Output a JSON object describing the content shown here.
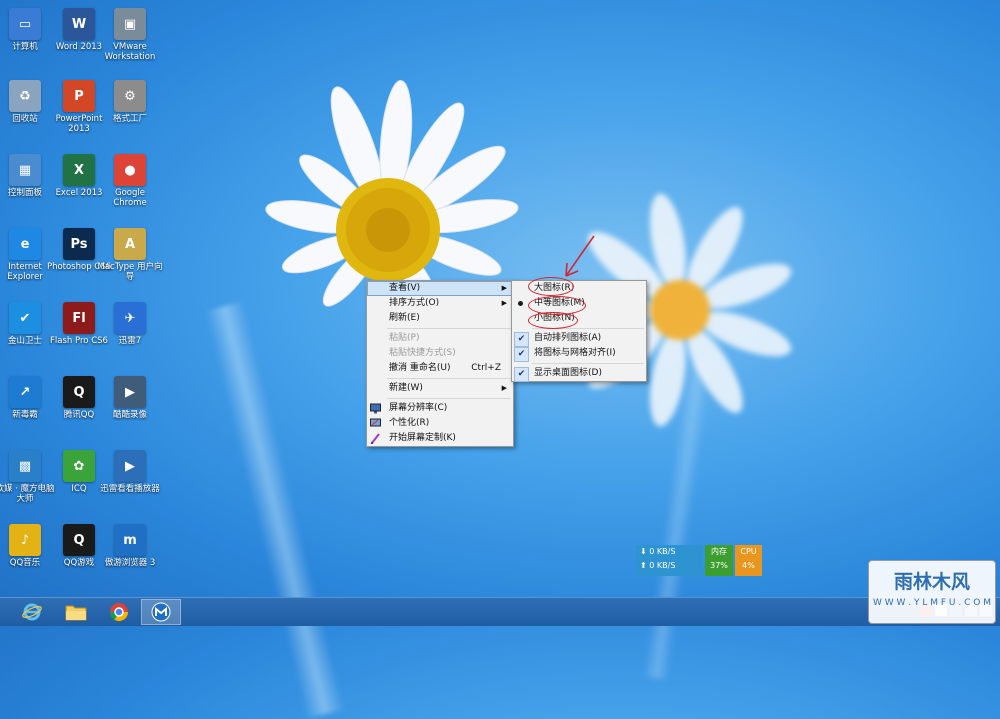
{
  "desktop_icons": [
    {
      "name": "desktop-icon-computer",
      "label": "计算机",
      "glyph": "▭",
      "color": "#3a7bd5",
      "col": 0,
      "row": 0
    },
    {
      "name": "desktop-icon-word",
      "label": "Word 2013",
      "glyph": "W",
      "color": "#2b579a",
      "col": 1,
      "row": 0
    },
    {
      "name": "desktop-icon-vmware",
      "label": "VMware Workstation",
      "glyph": "▣",
      "color": "#7a8b9a",
      "col": 2,
      "row": 0
    },
    {
      "name": "desktop-icon-recycle-bin",
      "label": "回收站",
      "glyph": "♻",
      "color": "#8aa4bf",
      "col": 0,
      "row": 1
    },
    {
      "name": "desktop-icon-powerpoint",
      "label": "PowerPoint 2013",
      "glyph": "P",
      "color": "#d24726",
      "col": 1,
      "row": 1
    },
    {
      "name": "desktop-icon-format-factory",
      "label": "格式工厂",
      "glyph": "⚙",
      "color": "#8c8c8c",
      "col": 2,
      "row": 1
    },
    {
      "name": "desktop-icon-control-panel",
      "label": "控制面板",
      "glyph": "▦",
      "color": "#4b8bd0",
      "col": 0,
      "row": 2
    },
    {
      "name": "desktop-icon-excel",
      "label": "Excel 2013",
      "glyph": "X",
      "color": "#217346",
      "col": 1,
      "row": 2
    },
    {
      "name": "desktop-icon-chrome",
      "label": "Google Chrome",
      "glyph": "●",
      "color": "#db4437",
      "col": 2,
      "row": 2
    },
    {
      "name": "desktop-icon-ie",
      "label": "Internet Explorer",
      "glyph": "e",
      "color": "#1e88e5",
      "col": 0,
      "row": 3
    },
    {
      "name": "desktop-icon-photoshop",
      "label": "Photoshop CS6",
      "glyph": "Ps",
      "color": "#0c2a4d",
      "col": 1,
      "row": 3
    },
    {
      "name": "desktop-icon-mactype",
      "label": "MacType 用户向导",
      "glyph": "A",
      "color": "#c9a94a",
      "col": 2,
      "row": 3
    },
    {
      "name": "desktop-icon-kingsoft-guard",
      "label": "金山卫士",
      "glyph": "✔",
      "color": "#1d8fe1",
      "col": 0,
      "row": 4
    },
    {
      "name": "desktop-icon-flash",
      "label": "Flash Pro CS6",
      "glyph": "Fl",
      "color": "#8e1b1b",
      "col": 1,
      "row": 4
    },
    {
      "name": "desktop-icon-xunlei",
      "label": "迅雷7",
      "glyph": "✈",
      "color": "#2a6fd6",
      "col": 2,
      "row": 4
    },
    {
      "name": "desktop-icon-xinduba",
      "label": "新毒霸",
      "glyph": "↗",
      "color": "#1e7bd2",
      "col": 0,
      "row": 5
    },
    {
      "name": "desktop-icon-qq",
      "label": "腾讯QQ",
      "glyph": "Q",
      "color": "#1a1a1a",
      "col": 1,
      "row": 5
    },
    {
      "name": "desktop-icon-kuku",
      "label": "酷酷录像",
      "glyph": "▶",
      "color": "#3f5d7a",
      "col": 2,
      "row": 5
    },
    {
      "name": "desktop-icon-magic-cube",
      "label": "软媒 · 魔方电脑大师",
      "glyph": "▩",
      "color": "#2a7fc9",
      "col": 0,
      "row": 6
    },
    {
      "name": "desktop-icon-icq",
      "label": "ICQ",
      "glyph": "✿",
      "color": "#3aa33a",
      "col": 1,
      "row": 6
    },
    {
      "name": "desktop-icon-xunlei-player",
      "label": "迅雷看看播放器",
      "glyph": "▶",
      "color": "#2c6fb8",
      "col": 2,
      "row": 6
    },
    {
      "name": "desktop-icon-qq-music",
      "label": "QQ音乐",
      "glyph": "♪",
      "color": "#e3b316",
      "col": 0,
      "row": 7
    },
    {
      "name": "desktop-icon-qq-game",
      "label": "QQ游戏",
      "glyph": "Q",
      "color": "#1a1a1a",
      "col": 1,
      "row": 7
    },
    {
      "name": "desktop-icon-maxthon",
      "label": "傲游浏览器 3",
      "glyph": "m",
      "color": "#1f6fc4",
      "col": 2,
      "row": 7
    }
  ],
  "context_menu": {
    "view": "查看(V)",
    "sort": "排序方式(O)",
    "refresh": "刷新(E)",
    "paste": "粘贴(P)",
    "paste_shortcut": "粘贴快捷方式(S)",
    "undo": "撤消 重命名(U)",
    "undo_shortcut": "Ctrl+Z",
    "new": "新建(W)",
    "resolution": "屏幕分辨率(C)",
    "personalize": "个性化(R)",
    "start_screen": "开始屏幕定制(K)"
  },
  "view_submenu": {
    "large_icons": "大图标(R)",
    "medium_icons": "中等图标(M)",
    "small_icons": "小图标(N)",
    "auto_arrange": "自动排列图标(A)",
    "align_grid": "将图标与网格对齐(I)",
    "show_desktop_icons": "显示桌面图标(D)"
  },
  "net_widget": {
    "download": "0 KB/S",
    "upload": "0 KB/S",
    "mem_label": "内存",
    "mem_value": "37%",
    "cpu_label": "CPU",
    "cpu_value": "4%"
  },
  "watermark": {
    "title": "雨林木风",
    "url": "W W W . Y L M F U . C O M"
  },
  "colors": {
    "annotation_red": "#d3262f",
    "menu_highlight": "#cfe3f7"
  }
}
